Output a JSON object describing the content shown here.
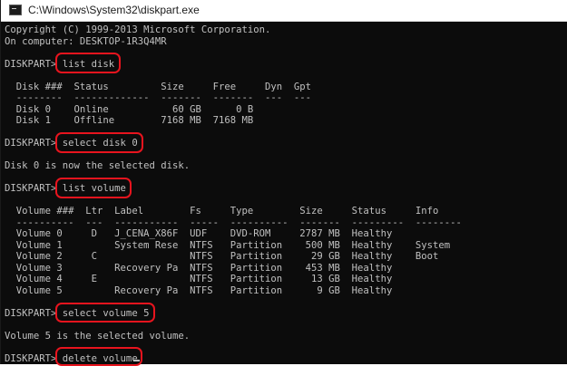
{
  "window": {
    "title": "C:\\Windows\\System32\\diskpart.exe"
  },
  "console": {
    "lines": [
      "Copyright (C) 1999-2013 Microsoft Corporation.",
      "On computer: DESKTOP-1R3Q4MR",
      "",
      "DISKPART> list disk",
      "",
      "  Disk ###  Status         Size     Free     Dyn  Gpt",
      "  --------  -------------  -------  -------  ---  ---",
      "  Disk 0    Online           60 GB      0 B",
      "  Disk 1    Offline        7168 MB  7168 MB",
      "",
      "DISKPART> select disk 0",
      "",
      "Disk 0 is now the selected disk.",
      "",
      "DISKPART> list volume",
      "",
      "  Volume ###  Ltr  Label        Fs     Type        Size     Status     Info",
      "  ----------  ---  -----------  -----  ----------  -------  ---------  --------",
      "  Volume 0     D   J_CENA_X86F  UDF    DVD-ROM     2787 MB  Healthy",
      "  Volume 1         System Rese  NTFS   Partition    500 MB  Healthy    System",
      "  Volume 2     C                NTFS   Partition     29 GB  Healthy    Boot",
      "  Volume 3         Recovery Pa  NTFS   Partition    453 MB  Healthy",
      "  Volume 4     E                NTFS   Partition     13 GB  Healthy",
      "  Volume 5         Recovery Pa  NTFS   Partition      9 GB  Healthy",
      "",
      "DISKPART> select volume 5",
      "",
      "Volume 5 is the selected volume.",
      "",
      "DISKPART> delete volume"
    ]
  },
  "highlights": [
    "list disk",
    "select disk 0",
    "list volume",
    "select volume 5",
    "delete volume"
  ],
  "colors": {
    "highlight": "#e8141e",
    "text": "#c0c0c0",
    "background": "#0c0c0c"
  }
}
